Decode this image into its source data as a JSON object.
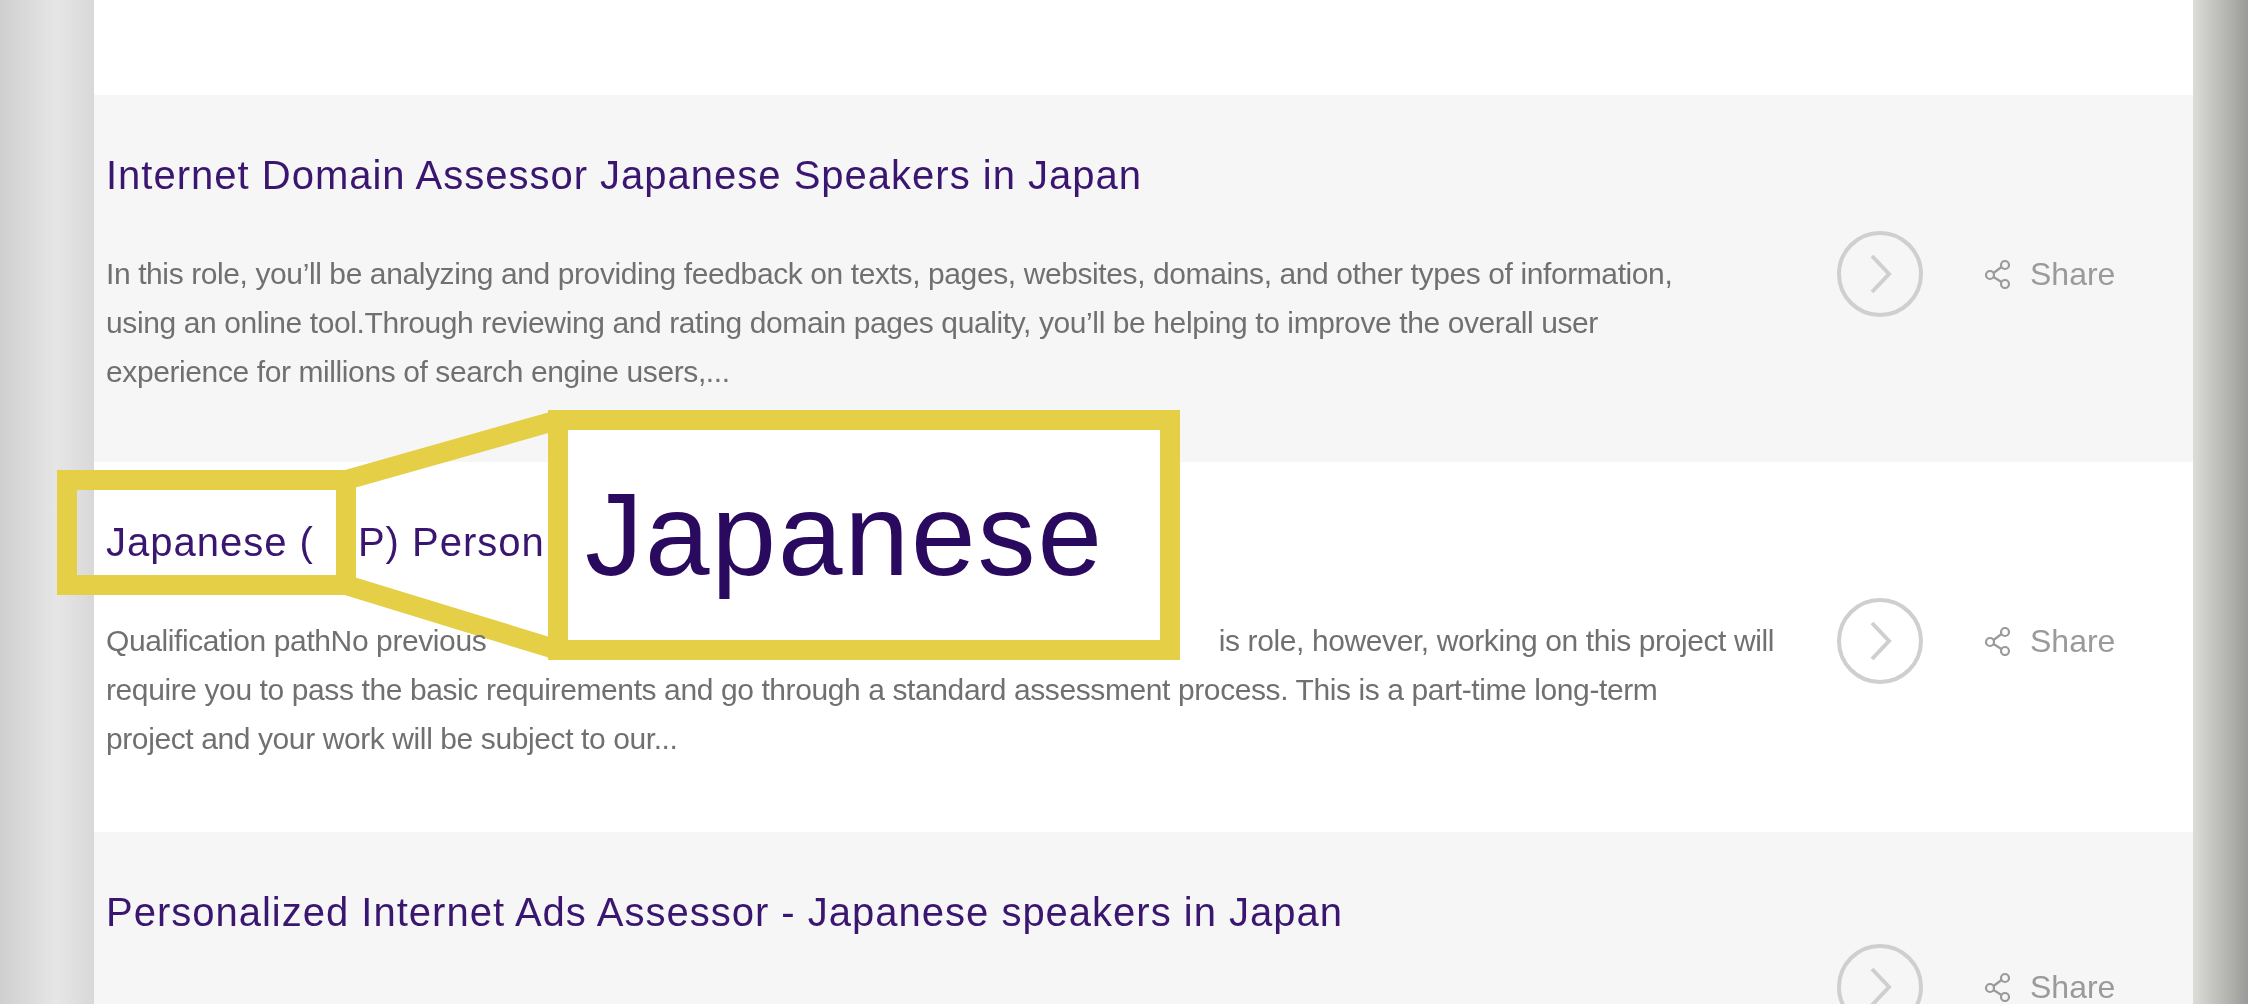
{
  "jobs": [
    {
      "title_parts": [
        "Internet Domain Assessor Japanese Speakers in Japan"
      ],
      "description_lines": [
        [
          "In this role, you’ll be analyzing and providing feedback on texts, pages, websites, domains, and other types of information,"
        ],
        [
          "using an online tool.Through reviewing and rating domain pages quality, you’ll be helping to improve the overall user"
        ],
        [
          "experience for millions of search engine users,..."
        ]
      ],
      "share": "Share"
    },
    {
      "title_parts": [
        "Japanese (",
        "P) Person"
      ],
      "description_lines": [
        [
          "Qualification pathNo previous",
          "is role, however, working on this project will"
        ],
        [
          "require you to pass the basic requirements and go through a standard assessment process. This is a part-time long-term"
        ],
        [
          "project and your work will be subject to our..."
        ]
      ],
      "share": "Share"
    },
    {
      "title_parts": [
        "Personalized Internet Ads Assessor - Japanese speakers in Japan"
      ],
      "share": "Share"
    }
  ],
  "callout": {
    "text": "Japanese"
  }
}
